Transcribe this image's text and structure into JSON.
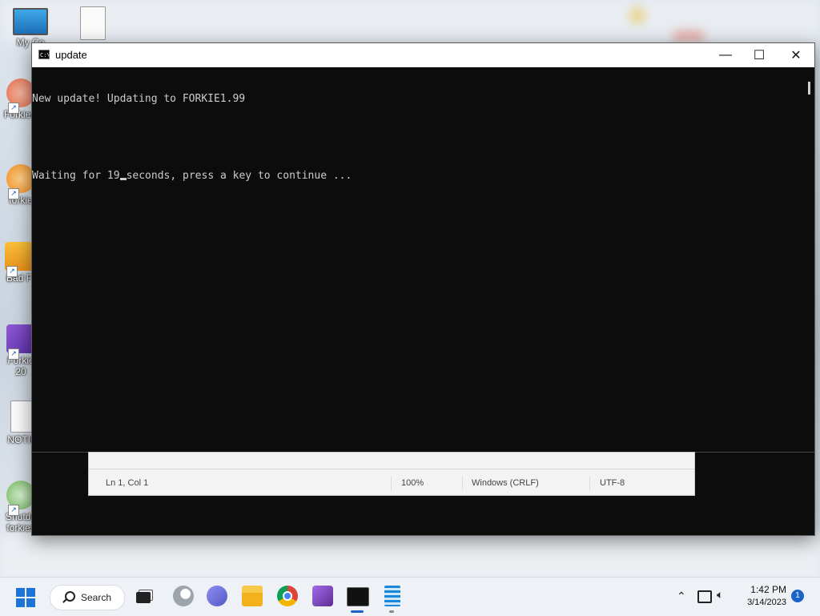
{
  "desktop": {
    "icons": [
      {
        "label": "My Co",
        "icon": "monitor-icon"
      },
      {
        "label": "",
        "icon": "text-file-icon"
      },
      {
        "label": "Forkiew",
        "icon": "app-shortcut-icon"
      },
      {
        "label": "forkie",
        "icon": "app-shortcut-icon"
      },
      {
        "label": "Bad F",
        "icon": "bad-piggies-icon"
      },
      {
        "label": "Forkie",
        "icon": "visual-studio-icon"
      },
      {
        "label": "20",
        "icon": ""
      },
      {
        "label": "NOTIC",
        "icon": "text-file-icon"
      },
      {
        "label": "Shutdo",
        "icon": "shutdown-icon"
      },
      {
        "label": "forkies",
        "icon": ""
      }
    ]
  },
  "window": {
    "title": "update",
    "minimize": "—",
    "maximize": "☐",
    "close": "✕"
  },
  "console": {
    "line1": "New update! Updating to FORKIE1.99",
    "line2_before": "Waiting for 19",
    "line2_after": "seconds, press a key to continue ..."
  },
  "notepad_status": {
    "position": "Ln 1, Col 1",
    "zoom": "100%",
    "line_ending": "Windows (CRLF)",
    "encoding": "UTF-8"
  },
  "taskbar": {
    "search_label": "Search",
    "time": "1:42 PM",
    "date": "3/14/2023",
    "notification_count": "1",
    "apps": [
      "start-icon",
      "search-icon",
      "task-view-icon",
      "edge-icon",
      "teams-chat-icon",
      "file-explorer-icon",
      "chrome-icon",
      "visual-studio-icon",
      "terminal-icon",
      "notepad-icon"
    ]
  },
  "colors": {
    "console_bg": "#0c0c0c",
    "console_text": "#cccccc",
    "taskbar_bg": "#eef1f5",
    "accent": "#1a63c8"
  }
}
